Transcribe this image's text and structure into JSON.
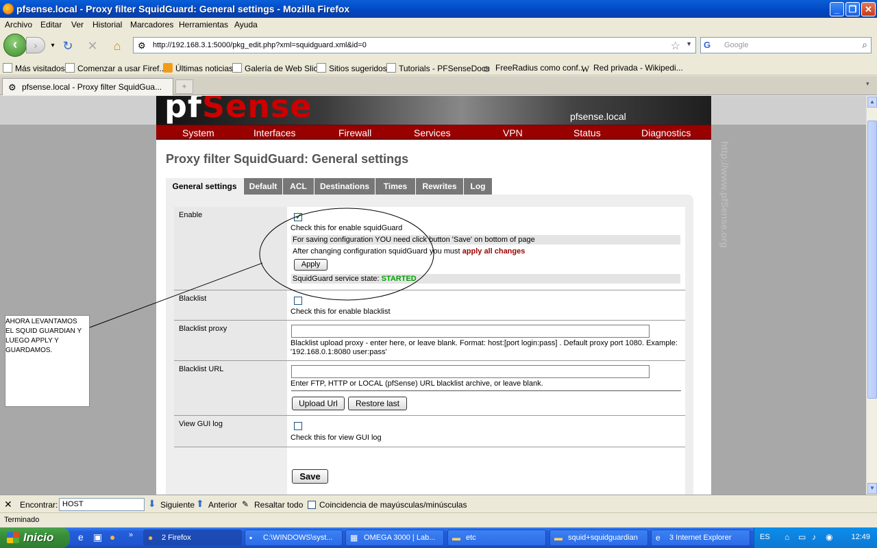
{
  "window": {
    "title": "pfsense.local - Proxy filter SquidGuard: General settings - Mozilla Firefox"
  },
  "menu": [
    "Archivo",
    "Editar",
    "Ver",
    "Historial",
    "Marcadores",
    "Herramientas",
    "Ayuda"
  ],
  "nav": {
    "url": "http://192.168.3.1:5000/pkg_edit.php?xml=squidguard.xml&id=0",
    "search_placeholder": "Google"
  },
  "bookmarks": [
    "Más visitados",
    "Comenzar a usar Firef...",
    "Últimas noticias",
    "Galería de Web Slice",
    "Sitios sugeridos",
    "Tutorials - PFSenseDocs",
    "FreeRadius como conf...",
    "Red privada - Wikipedi..."
  ],
  "browser_tab": {
    "title": "pfsense.local - Proxy filter SquidGua...",
    "new_tab": "+"
  },
  "pfsense": {
    "hostname": "pfsense.local",
    "logo_pf": "pf",
    "logo_sense": "Sense",
    "menu": [
      "System",
      "Interfaces",
      "Firewall",
      "Services",
      "VPN",
      "Status",
      "Diagnostics"
    ],
    "page_title": "Proxy filter SquidGuard: General settings",
    "tabs": [
      "General settings",
      "Default",
      "ACL",
      "Destinations",
      "Times",
      "Rewrites",
      "Log"
    ],
    "watermark": "http://www.pfSense.org"
  },
  "form": {
    "enable": {
      "label": "Enable",
      "checked": true,
      "desc": "Check this for enable squidGuard",
      "save_note": "For saving configuration YOU need click button 'Save' on bottom of page",
      "apply_note_prefix": "After changing configuration squidGuard you must ",
      "apply_note_link": "apply all changes",
      "apply_button": "Apply",
      "state_prefix": "SquidGuard service state: ",
      "state_value": "STARTED"
    },
    "blacklist": {
      "label": "Blacklist",
      "checked": false,
      "desc": "Check this for enable blacklist"
    },
    "blacklist_proxy": {
      "label": "Blacklist proxy",
      "value": "",
      "desc_line1": "Blacklist upload proxy - enter here, or leave blank. Format: host:[port login:pass] . Default proxy port 1080. Example:",
      "desc_line2": "'192.168.0.1:8080 user:pass'"
    },
    "blacklist_url": {
      "label": "Blacklist URL",
      "value": "",
      "desc": "Enter FTP, HTTP or LOCAL (pfSense) URL blacklist archive, or leave blank.",
      "upload_button": "Upload Url",
      "restore_button": "Restore last"
    },
    "gui_log": {
      "label": "View GUI log",
      "checked": false,
      "desc": "Check this for view GUI log"
    },
    "save_button": "Save"
  },
  "annotation": {
    "text": "AHORA LEVANTAMOS\nEL SQUID GUARDIAN Y\nLUEGO APPLY Y\nGUARDAMOS."
  },
  "findbar": {
    "label": "Encontrar:",
    "value": "HOST",
    "next": "Siguiente",
    "prev": "Anterior",
    "highlight": "Resaltar todo",
    "match_case": "Coincidencia de mayúsculas/minúsculas"
  },
  "status": "Terminado",
  "taskbar": {
    "start": "Inicio",
    "tasks": [
      "2 Firefox",
      "C:\\WINDOWS\\syst...",
      "OMEGA 3000 | Lab...",
      "etc",
      "squid+squidguardian",
      "3 Internet Explorer"
    ],
    "lang": "ES",
    "clock": "12:49"
  }
}
